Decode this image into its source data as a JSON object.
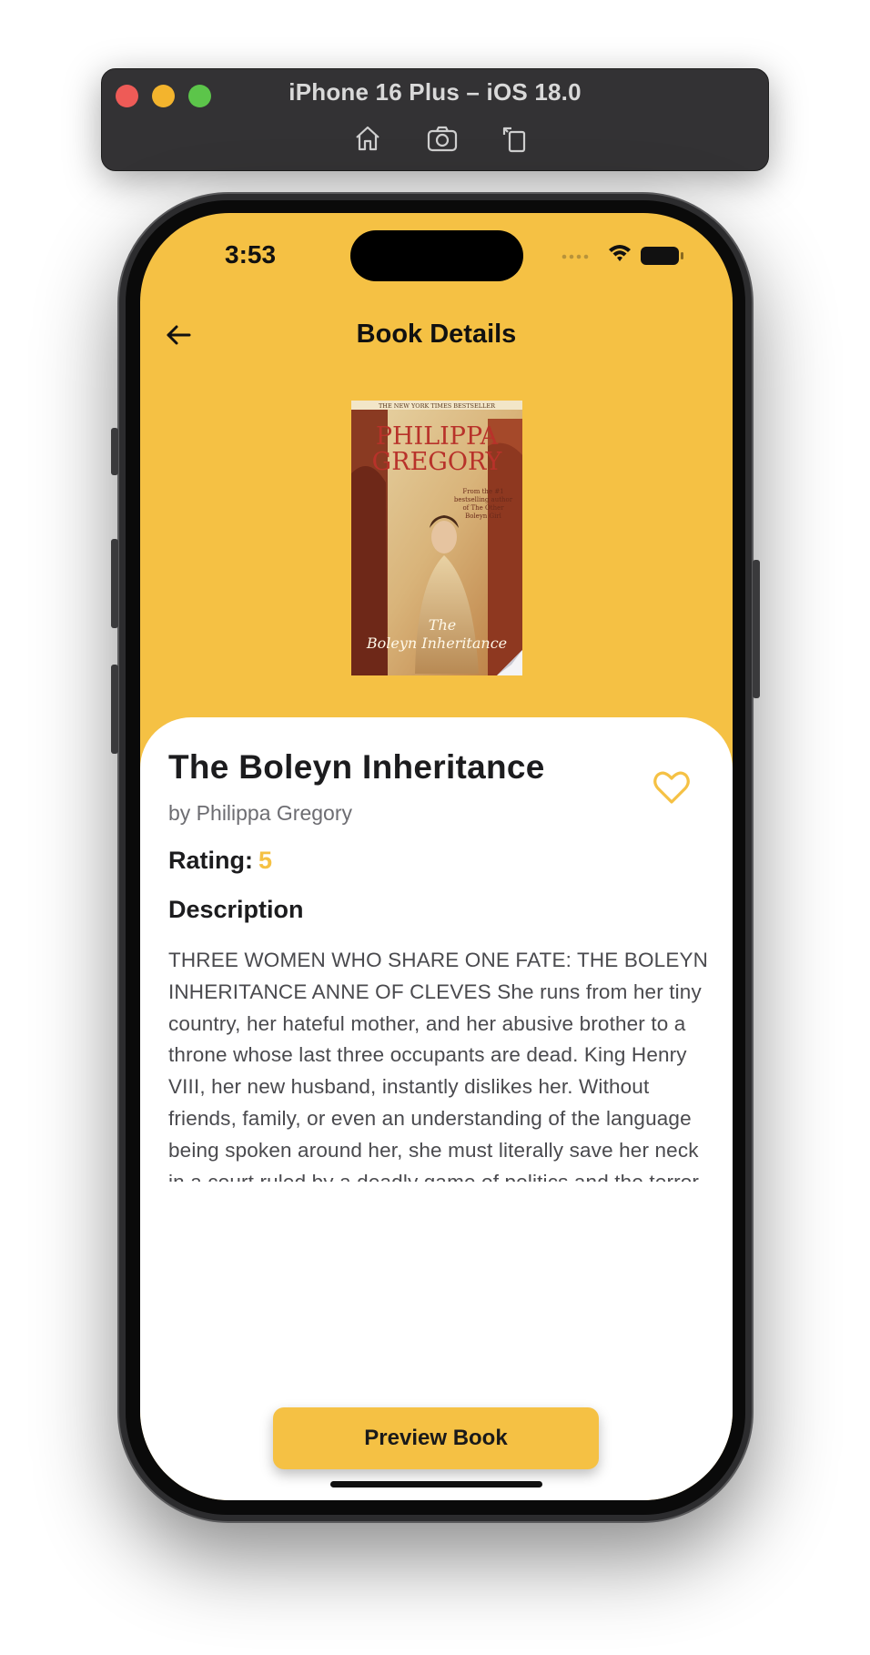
{
  "simulator": {
    "title": "iPhone 16 Plus – iOS 18.0",
    "tools": [
      "home-icon",
      "screenshot-icon",
      "rotate-icon"
    ]
  },
  "status_bar": {
    "time": "3:53",
    "icons": [
      "signal-icon",
      "wifi-icon",
      "battery-icon"
    ]
  },
  "header": {
    "title": "Book Details",
    "back_icon": "arrow-left-icon"
  },
  "cover": {
    "banner": "THE NEW YORK TIMES BESTSELLER",
    "author_line1": "PHILIPPA",
    "author_line2": "GREGORY",
    "blurb": "From the #1 bestselling author of The Other Boleyn Girl",
    "title_line1": "The",
    "title_line2": "Boleyn Inheritance"
  },
  "book": {
    "title": "The Boleyn Inheritance",
    "author": "by Philippa Gregory",
    "rating_label": "Rating:",
    "rating_value": "5",
    "description_heading": "Description",
    "description": "THREE WOMEN WHO SHARE ONE FATE: THE BOLEYN INHERITANCE ANNE OF CLEVES She runs from her tiny country, her hateful mother, and her abusive brother to a throne whose last three occupants are dead. King Henry VIII, her new husband, instantly dislikes her. Without friends, family, or even an understanding of the language being spoken around her, she must literally save her neck in a court ruled by a deadly game of politics and the terror of an unpredictable and vengeful king. Her Boleyn Inheritance: accusations and false witnesses. KATHERINE HOWARD She catches the king's eye within moments of arriving at court, setting in",
    "favorite_icon": "heart-outline-icon"
  },
  "actions": {
    "preview_label": "Preview Book"
  },
  "colors": {
    "accent": "#f5c144",
    "background_sheet": "#ffffff",
    "text_primary": "#1c1c1e",
    "text_secondary": "#6d6d72"
  }
}
